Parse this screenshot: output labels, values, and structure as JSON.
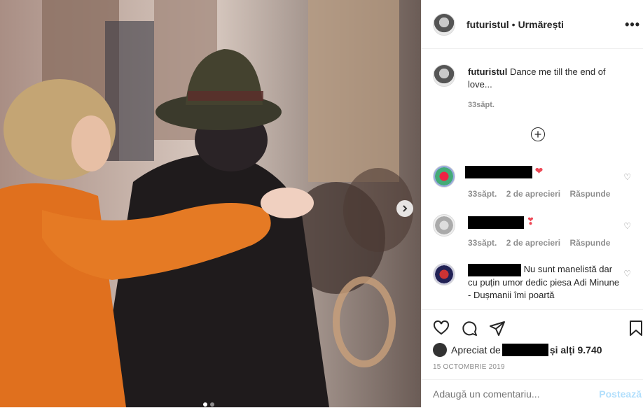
{
  "post": {
    "username": "futuristul",
    "separator": "•",
    "follow_label": "Urmărești",
    "more_label": "•••"
  },
  "caption": {
    "username": "futuristul",
    "text": "Dance me till the end of love...",
    "time": "33săpt."
  },
  "load_more_label": "+",
  "comments": [
    {
      "redacted": true,
      "text": "",
      "emoji": "❤",
      "time": "33săpt.",
      "likes": "2 de aprecieri",
      "reply": "Răspunde"
    },
    {
      "redacted": true,
      "text": "",
      "emoji": "❣",
      "time": "33săpt.",
      "likes": "2 de aprecieri",
      "reply": "Răspunde"
    },
    {
      "redacted": true,
      "text": "Nu sunt manelistă dar cu puțin umor dedic piesa Adi Minune - Dușmanii îmi poartă",
      "emoji": "",
      "time": "",
      "likes": "",
      "reply": ""
    }
  ],
  "likes": {
    "prefix": "Apreciat de",
    "suffix": "și alți 9.740"
  },
  "date": "15 OCTOMBRIE 2019",
  "add_comment": {
    "placeholder": "Adaugă un comentariu...",
    "post_label": "Postează"
  },
  "colors": {
    "dress": "#e0701e",
    "muted": "#8e8e8e",
    "heart_red": "#ed4956",
    "post_blue": "#b2dffc"
  },
  "icons": {
    "like": "heart-outline",
    "comment": "speech-bubble",
    "share": "paper-plane",
    "save": "bookmark",
    "next": "chevron-right"
  },
  "carousel": {
    "slides": 2,
    "current": 1
  }
}
